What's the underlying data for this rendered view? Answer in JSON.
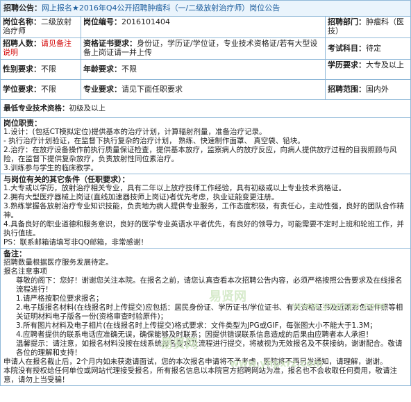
{
  "header": {
    "label": "招聘公告：",
    "title": "网上报名★2016年Q4公开招聘肿瘤科（一/二级放射治疗师）岗位公告"
  },
  "grid": {
    "row1": {
      "name_label": "岗位名称：",
      "name_value": "二级放射治疗师",
      "code_label": "岗位编号：",
      "code_value": "2016101404",
      "dept_label": "招聘部门：",
      "dept_value": "肿瘤科（医技）"
    },
    "row2": {
      "count_label": "招聘人数：",
      "count_value": "请见备注说明",
      "cert_label": "资格证书要求：",
      "cert_value": "身份证，学历证/学位证，专业技术资格证/若有大型设备上岗证请一并上传",
      "exam_label": "考试科目：",
      "exam_value": "待定"
    },
    "row3": {
      "gender_label": "性别要求：",
      "gender_value": "不限",
      "age_label": "年龄要求：",
      "age_value": "不限",
      "edu_label": "学历要求：",
      "edu_value": "大专及以上"
    },
    "row4": {
      "degree_label": "学位要求：",
      "degree_value": "不限",
      "major_label": "专业要求：",
      "major_value": "请见下面任职要求",
      "scope_label": "招聘范围：",
      "scope_value": "国内外"
    }
  },
  "min_title": {
    "label": "最低专业技术资格：",
    "value": "初级及以上"
  },
  "duties": {
    "head": "岗位职责：",
    "lines": [
      "1.设计：(包括CT模拟定位)提供基本的治疗计划，计算辐射剂量，准备治疗记录。",
      "- 执行治疗计划验证，在监督下执行复杂的治疗计划， 熟练、快速制作面罩、 真空袋、铅块。",
      "2.治疗：在放疗设备操作前执行质量保证检查，提供基本放疗，监察病人的放疗反应，向病人提供放疗过程的目我照顾与风险，在监督下提供复杂放疗，负责放射性同位素治疗。",
      "3.训练参与学生的临床教学。"
    ]
  },
  "conditions": {
    "head": "与岗位有关的其它条件（任职要求）：",
    "lines": [
      "1.大专或以学历，放射治疗相关专业，具有二年以上放疗技师工作经验，具有初级或以上专业技术资格证。",
      "2.拥有大型医疗器械上岗证(直线加速器技师上岗证)者优先考虑，执业证能变更注册。",
      "3.熟练掌握各放射治疗专业知识技能，负责地为病人提供专业服务，工作态度积极，有责任心，主动性强，良好的团队合作精神。",
      "4.具备良好的职业道德和服务意识，良好的医学专业英语水平者优先，有良好的领导力，可能需要不定时上班和轮班工作，并执行值班。",
      "PS：联系邮箱请填写非QQ邮箱，非常感谢！"
    ]
  },
  "notes": {
    "head": "备注：",
    "lines": [
      "招聘数量根据医疗服务发展待定。",
      "报名注意事项",
      "尊敬的阁下：您好！谢谢您关注本院。在报名之前，请您认真查看本次招聘公告内容，必须严格按照公告要求及在线报名流程进行！",
      "1.请严格按职位要求报名；",
      "2.电子版报名材料(在线报名时上传提交)应包括：居民身份证、学历证书/学位证书、有关资格证书及近期彩色证件照等相关证明材料电子版各一份(资格审查时验原件)；",
      "3.所有图片材料及电子相片(在线报名时上传提交)格式要求：文件类型为JPG或GIF，每张图大小不能大于1.3M；",
      "4.应聘者提供的联系电话应准确无误，确保能够及时联系；因提供错误联系信息造成的后果由应聘者本人承担！",
      "温馨提示：请注意，如报名材料没按在线系统报名要求及流程进行提交，将被视为无效报名及不获接纳，谢谢配合。敬请各位的理解和支持！",
      "申请人在报名截止后，2个月内如未获邀请面试，您的本次报名申请将不予考虑，医院将不再另发通知，请理解，谢谢。",
      "本院没有授权给任何单位或网站代理接受报名，所有报名信息以本院官方招聘网站为准，报名也不会收取任何费用，敬请注意，请勿上当受骗！"
    ]
  },
  "watermarks": [
    "易贤网",
    "www.ynpxrz.com",
    "易贤网",
    "www.ynpxrz.com"
  ]
}
